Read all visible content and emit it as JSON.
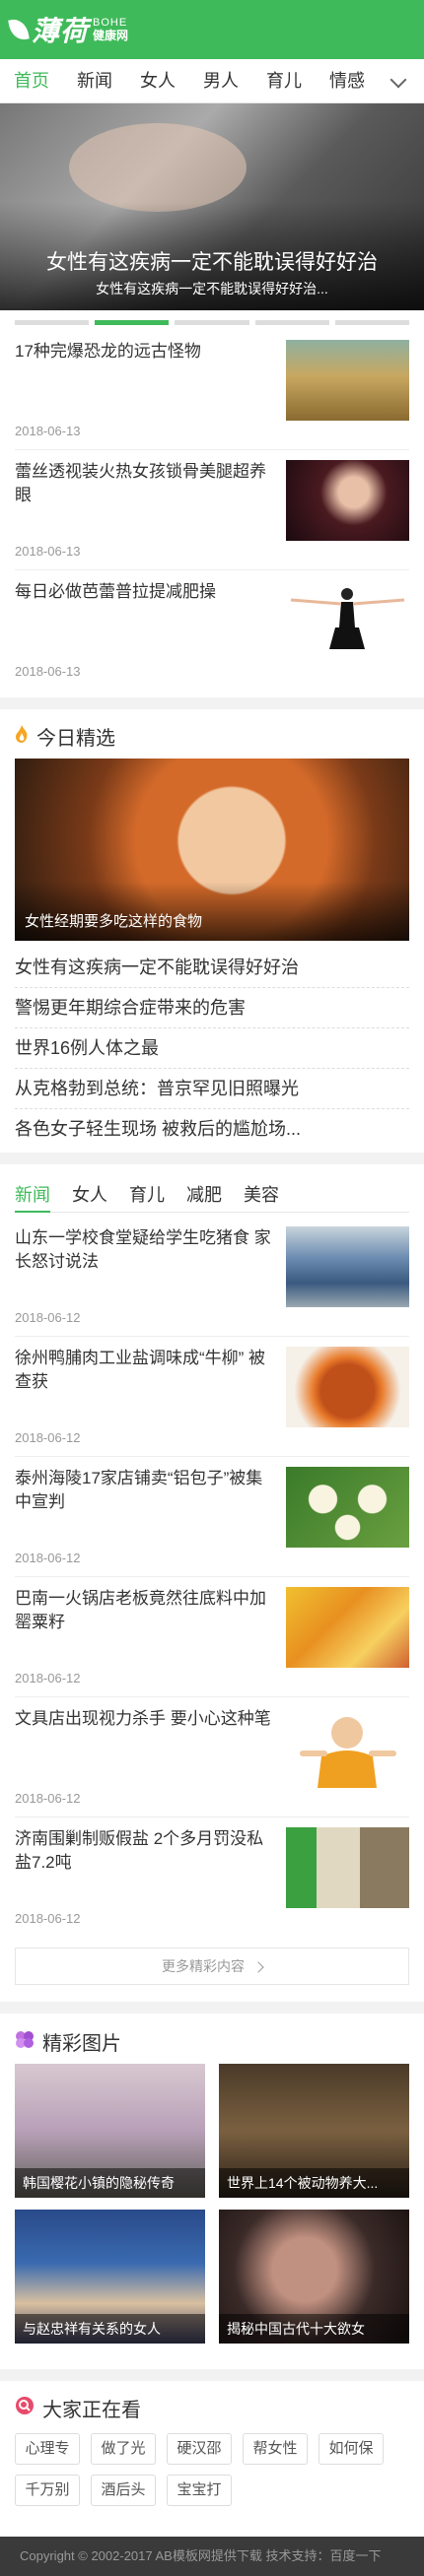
{
  "header": {
    "logo_cn": "薄荷",
    "logo_en": "BOHE",
    "logo_cn2": "健康网",
    "brand_color": "#3fba5a"
  },
  "nav": {
    "items": [
      "首页",
      "新闻",
      "女人",
      "男人",
      "育儿",
      "情感"
    ],
    "more_icon": "chevron-down-icon"
  },
  "banner": {
    "title": "女性有这疾病一定不能耽误得好好治",
    "subtitle": "女性有这疾病一定不能耽误得好好治..."
  },
  "top_list": [
    {
      "title": "17种完爆恐龙的远古怪物",
      "date": "2018-06-13"
    },
    {
      "title": "蕾丝透视装火热女孩锁骨美腿超养眼",
      "date": "2018-06-13"
    },
    {
      "title": "每日必做芭蕾普拉提减肥操",
      "date": "2018-06-13"
    }
  ],
  "today": {
    "title": "今日精选",
    "feature_caption": "女性经期要多吃这样的食物",
    "links": [
      "女性有这疾病一定不能耽误得好好治",
      "警惕更年期综合症带来的危害",
      "世界16例人体之最",
      "从克格勃到总统：普京罕见旧照曝光",
      "各色女子轻生现场 被救后的尴尬场..."
    ]
  },
  "news": {
    "tabs": [
      "新闻",
      "女人",
      "育儿",
      "减肥",
      "美容"
    ],
    "items": [
      {
        "title": "山东一学校食堂疑给学生吃猪食 家长怒讨说法",
        "date": "2018-06-12"
      },
      {
        "title": "徐州鸭脯肉工业盐调味成“牛柳” 被查获",
        "date": "2018-06-12"
      },
      {
        "title": "泰州海陵17家店铺卖“铝包子”被集中宣判",
        "date": "2018-06-12"
      },
      {
        "title": "巴南一火锅店老板竟然往底料中加罂粟籽",
        "date": "2018-06-12"
      },
      {
        "title": "文具店出现视力杀手 要小心这种笔",
        "date": "2018-06-12"
      },
      {
        "title": "济南围剿制贩假盐 2个多月罚没私盐7.2吨",
        "date": "2018-06-12"
      }
    ],
    "more_label": "更多精彩内容"
  },
  "gallery": {
    "title": "精彩图片",
    "items": [
      "韩国樱花小镇的隐秘传奇",
      "世界上14个被动物养大...",
      "与赵忠祥有关系的女人",
      "揭秘中国古代十大欲女"
    ]
  },
  "watching": {
    "title": "大家正在看",
    "tags": [
      "心理专",
      "做了光",
      "硬汉邵",
      "帮女性",
      "如何保",
      "千万别",
      "酒后头",
      "宝宝打"
    ]
  },
  "footer": {
    "text": "Copyright © 2002-2017 AB模板网提供下载 技术支持：百度一下"
  }
}
